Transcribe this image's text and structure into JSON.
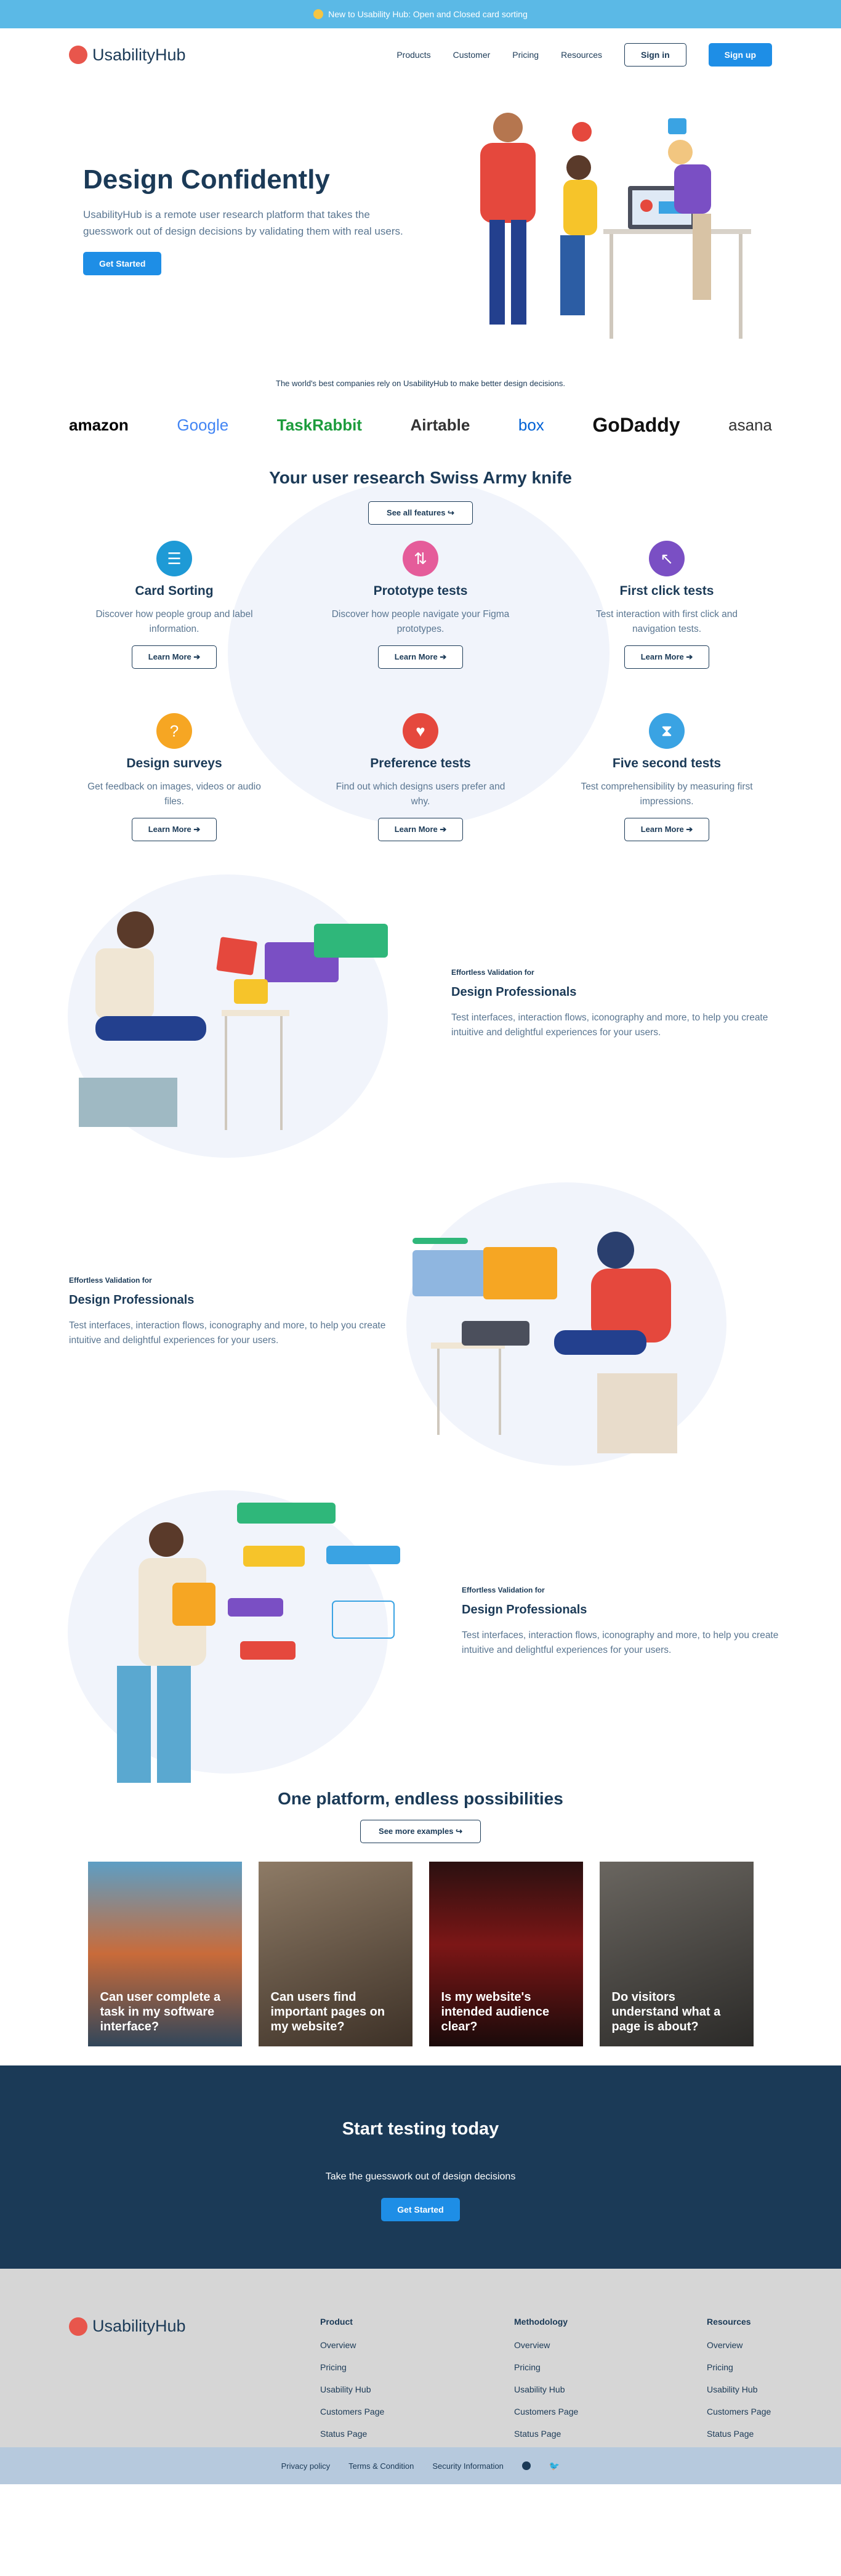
{
  "banner": {
    "text": "New to Usability Hub: Open and Closed card sorting"
  },
  "nav": {
    "brand": "UsabilityHub",
    "links": [
      "Products",
      "Customer",
      "Pricing",
      "Resources"
    ],
    "sign_in": "Sign in",
    "sign_up": "Sign up"
  },
  "hero": {
    "title": "Design Confidently",
    "subtitle": "UsabilityHub is a remote user research platform that takes the guesswork out of design decisions by validating them with real users.",
    "cta": "Get Started"
  },
  "logos": {
    "caption": "The world's best companies rely on UsabilityHub to make better design decisions.",
    "items": [
      "amazon",
      "Google",
      "TaskRabbit",
      "Airtable",
      "box",
      "GoDaddy",
      "asana"
    ]
  },
  "features": {
    "title": "Your user research Swiss Army knife",
    "see_all": "See all features",
    "cards": [
      {
        "title": "Card Sorting",
        "desc": "Discover how people group and label information.",
        "cta": "Learn More",
        "icon": "card-sorting-icon",
        "color": "#1e9ad6"
      },
      {
        "title": "Prototype tests",
        "desc": "Discover how people navigate your Figma prototypes.",
        "cta": "Learn More",
        "icon": "prototype-icon",
        "color": "#e55c9a"
      },
      {
        "title": "First click tests",
        "desc": "Test interaction with first click and navigation tests.",
        "cta": "Learn More",
        "icon": "cursor-icon",
        "color": "#7a4fc4"
      },
      {
        "title": "Design surveys",
        "desc": "Get feedback on images, videos or audio files.",
        "cta": "Learn More",
        "icon": "question-icon",
        "color": "#f6a623"
      },
      {
        "title": "Preference tests",
        "desc": "Find out which designs users prefer and why.",
        "cta": "Learn More",
        "icon": "heart-icon",
        "color": "#e5483d"
      },
      {
        "title": "Five second tests",
        "desc": "Test comprehensibility by measuring first impressions.",
        "cta": "Learn More",
        "icon": "hourglass-icon",
        "color": "#3aa3e3"
      }
    ]
  },
  "sections": [
    {
      "kicker": "Effortless Validation for",
      "title": "Design Professionals",
      "desc": "Test interfaces, interaction flows, iconography and more, to help you create intuitive and delightful experiences for your users."
    },
    {
      "kicker": "Effortless Validation for",
      "title": "Design Professionals",
      "desc": "Test interfaces, interaction flows, iconography and more, to help you create intuitive and delightful experiences for your users."
    },
    {
      "kicker": "Effortless Validation for",
      "title": "Design Professionals",
      "desc": "Test interfaces, interaction flows, iconography and more, to help you create intuitive and delightful experiences for your users."
    }
  ],
  "platform": {
    "title": "One platform, endless possibilities",
    "see_more": "See more examples",
    "tiles": [
      {
        "q": "Can user complete a task in my software interface?"
      },
      {
        "q": "Can users find important pages on my website?"
      },
      {
        "q": "Is my website's intended audience clear?"
      },
      {
        "q": "Do visitors understand what a page is about?"
      }
    ]
  },
  "cta": {
    "title": "Start testing today",
    "subtitle": "Take the guesswork out of design decisions",
    "button": "Get Started"
  },
  "footer": {
    "brand": "UsabilityHub",
    "columns": [
      {
        "title": "Product",
        "items": [
          "Overview",
          "Pricing",
          "Usability Hub",
          "Customers Page",
          "Status Page"
        ]
      },
      {
        "title": "Methodology",
        "items": [
          "Overview",
          "Pricing",
          "Usability Hub",
          "Customers Page",
          "Status Page"
        ]
      },
      {
        "title": "Resources",
        "items": [
          "Overview",
          "Pricing",
          "Usability Hub",
          "Customers Page",
          "Status Page"
        ]
      }
    ],
    "bottom": [
      "Privacy policy",
      "Terms & Condition",
      "Security Information"
    ]
  }
}
